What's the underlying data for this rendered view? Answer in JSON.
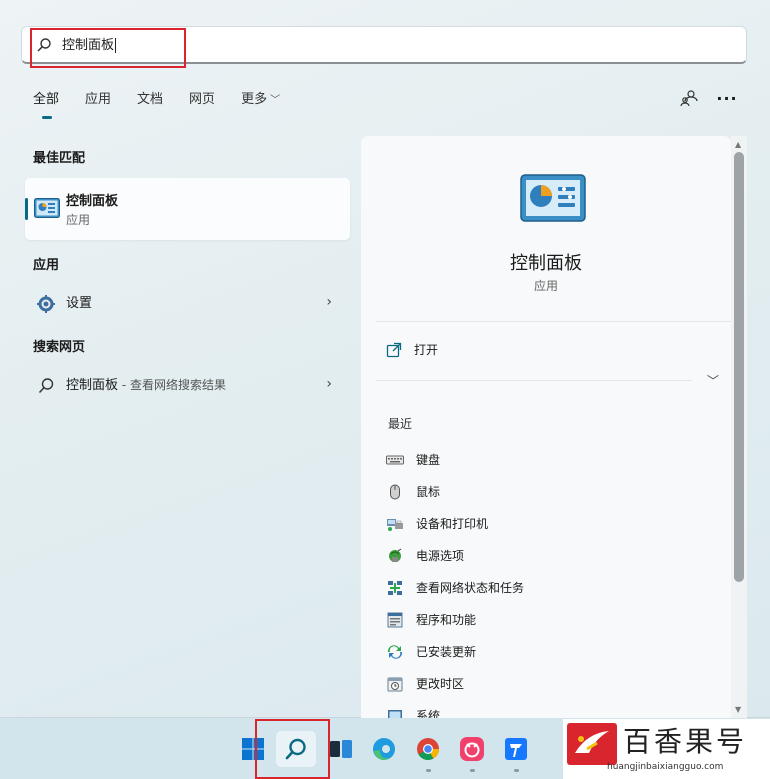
{
  "search": {
    "value": "控制面板"
  },
  "tabs": [
    {
      "label": "全部"
    },
    {
      "label": "应用"
    },
    {
      "label": "文档"
    },
    {
      "label": "网页"
    },
    {
      "label": "更多"
    }
  ],
  "sections": {
    "best_match": "最佳匹配",
    "apps": "应用",
    "web": "搜索网页"
  },
  "best_match": {
    "title": "控制面板",
    "subtitle": "应用",
    "icon": "control-panel-icon"
  },
  "apps": [
    {
      "label": "设置",
      "icon": "gear-icon"
    }
  ],
  "web": [
    {
      "label": "控制面板",
      "suffix": " - 查看网络搜索结果",
      "icon": "search-icon"
    }
  ],
  "detail": {
    "title": "控制面板",
    "subtitle": "应用",
    "action": "打开",
    "recent_heading": "最近",
    "recent": [
      {
        "label": "键盘",
        "icon": "keyboard-icon"
      },
      {
        "label": "鼠标",
        "icon": "mouse-icon"
      },
      {
        "label": "设备和打印机",
        "icon": "printer-icon"
      },
      {
        "label": "电源选项",
        "icon": "power-icon"
      },
      {
        "label": "查看网络状态和任务",
        "icon": "network-icon"
      },
      {
        "label": "程序和功能",
        "icon": "programs-icon"
      },
      {
        "label": "已安装更新",
        "icon": "updates-icon"
      },
      {
        "label": "更改时区",
        "icon": "clock-icon"
      },
      {
        "label": "系统",
        "icon": "system-icon"
      }
    ]
  },
  "taskbar": [
    "windows-logo-icon",
    "search-icon",
    "task-view-icon",
    "edge-icon",
    "chrome-icon",
    "app-icon",
    "store-icon"
  ],
  "watermark": {
    "name": "百香果号",
    "url": "huangjinbaixiangguo.com"
  },
  "colors": {
    "accent": "#0a6a82",
    "highlight": "#d9262e"
  }
}
